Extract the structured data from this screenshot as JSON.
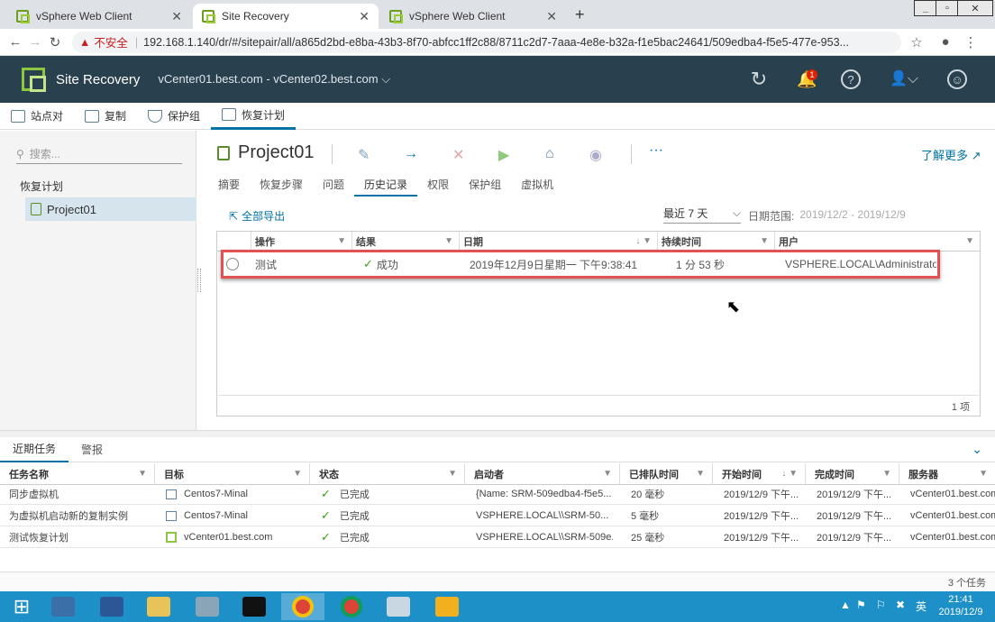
{
  "browser": {
    "tabs": [
      {
        "title": "vSphere Web Client",
        "active": false
      },
      {
        "title": "Site Recovery",
        "active": true
      },
      {
        "title": "vSphere Web Client",
        "active": false
      }
    ],
    "new_tab": "+",
    "security_label": "不安全",
    "url": "192.168.1.140/dr/#/sitepair/all/a865d2bd-e8ba-43b3-8f70-abfcc1ff2c88/8711c2d7-7aaa-4e8e-b32a-f1e5bac24641/509edba4-f5e5-477e-953..."
  },
  "app": {
    "title": "Site Recovery",
    "vcenter_pair": "vCenter01.best.com - vCenter02.best.com",
    "notification_count": "1",
    "accent": "#0072a3",
    "header_bg": "#29414e"
  },
  "nav_tabs": [
    "站点对",
    "复制",
    "保护组",
    "恢复计划"
  ],
  "left": {
    "search_placeholder": "搜索...",
    "tree_header": "恢复计划",
    "tree_item": "Project01"
  },
  "main": {
    "title": "Project01",
    "learn_more": "了解更多",
    "more": "···",
    "subtabs": [
      "摘要",
      "恢复步骤",
      "问题",
      "历史记录",
      "权限",
      "保护组",
      "虚拟机"
    ],
    "active_subtab": "历史记录",
    "export_all": "全部导出",
    "range_select": "最近 7 天",
    "date_range_label": "日期范围:",
    "date_range_value": "2019/12/2 - 2019/12/9",
    "grid": {
      "columns": [
        "操作",
        "结果",
        "日期",
        "持续时间",
        "用户"
      ],
      "rows": [
        {
          "operation": "测试",
          "result": "成功",
          "date": "2019年12月9日星期一 下午9:38:41",
          "duration": "1 分 53 秒",
          "user": "VSPHERE.LOCAL\\Administrator"
        }
      ],
      "footer": "1 项"
    }
  },
  "bottom": {
    "tabs": [
      "近期任务",
      "警报"
    ],
    "columns": [
      "任务名称",
      "目标",
      "状态",
      "启动者",
      "已排队时间",
      "开始时间",
      "完成时间",
      "服务器"
    ],
    "rows": [
      {
        "task": "同步虚拟机",
        "target": "Centos7-Minal",
        "target_type": "vm",
        "status": "已完成",
        "initiator": "{Name: SRM-509edba4-f5e5...",
        "queued": "20 毫秒",
        "start": "2019/12/9 下午...",
        "end": "2019/12/9 下午...",
        "server": "vCenter01.best.com"
      },
      {
        "task": "为虚拟机启动新的复制实例",
        "target": "Centos7-Minal",
        "target_type": "vm",
        "status": "已完成",
        "initiator": "VSPHERE.LOCAL\\\\SRM-50...",
        "queued": "5 毫秒",
        "start": "2019/12/9 下午...",
        "end": "2019/12/9 下午...",
        "server": "vCenter01.best.com"
      },
      {
        "task": "测试恢复计划",
        "target": "vCenter01.best.com",
        "target_type": "vc",
        "status": "已完成",
        "initiator": "VSPHERE.LOCAL\\\\SRM-509e...",
        "queued": "25 毫秒",
        "start": "2019/12/9 下午...",
        "end": "2019/12/9 下午...",
        "server": "vCenter01.best.com"
      }
    ],
    "footer": "3 个任务"
  },
  "taskbar": {
    "time": "21:41",
    "date": "2019/12/9",
    "ime": "英"
  }
}
